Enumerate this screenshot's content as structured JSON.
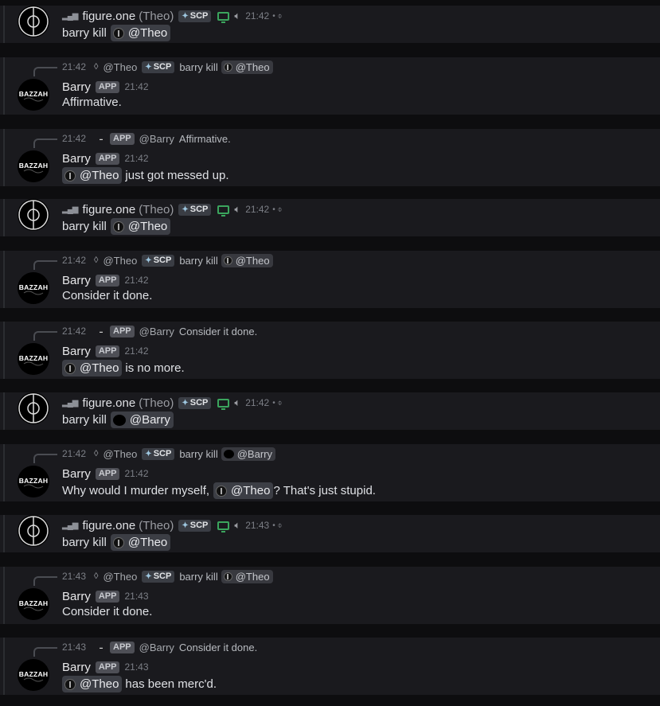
{
  "colors": {
    "background": "#0d0d0f",
    "message_bg": "#1a1a1e",
    "mention_bg": "#3c3e45",
    "app_tag": "#4e4f56",
    "screen_share": "#3ba55d"
  },
  "icons": {
    "figure_avatar": "crosshair-circle",
    "bazzah_avatar": "bazzah-logo",
    "signal": "signal-bars-icon",
    "screen": "screen-share-icon",
    "speaker": "speaker-icon"
  },
  "messages": [
    {
      "kind": "figure",
      "name": "figure.one",
      "alias": "(Theo)",
      "tag": "SCP",
      "time": "21:42",
      "suffix": "• ⌽",
      "text": "barry kill",
      "mention": "@Theo",
      "mention_type": "theo"
    },
    {
      "kind": "barry",
      "reply": {
        "time": "21:42",
        "name": "@Theo",
        "tag": "SCP",
        "text": "barry kill",
        "mention": "@Theo",
        "mention_type": "theo"
      },
      "name": "Barry",
      "tag": "APP",
      "time": "21:42",
      "pre": "",
      "mention": "",
      "post": "Affirmative."
    },
    {
      "kind": "barry",
      "reply": {
        "time": "21:42",
        "name": "@Barry",
        "tag": "APP",
        "text": "Affirmative.",
        "mention": "",
        "mention_type": ""
      },
      "name": "Barry",
      "tag": "APP",
      "time": "21:42",
      "pre": "",
      "mention": "@Theo",
      "post": "just got messed up."
    },
    {
      "kind": "figure",
      "name": "figure.one",
      "alias": "(Theo)",
      "tag": "SCP",
      "time": "21:42",
      "suffix": "• ⌽",
      "text": "barry kill",
      "mention": "@Theo",
      "mention_type": "theo"
    },
    {
      "kind": "barry",
      "reply": {
        "time": "21:42",
        "name": "@Theo",
        "tag": "SCP",
        "text": "barry kill",
        "mention": "@Theo",
        "mention_type": "theo"
      },
      "name": "Barry",
      "tag": "APP",
      "time": "21:42",
      "pre": "",
      "mention": "",
      "post": "Consider it done."
    },
    {
      "kind": "barry",
      "reply": {
        "time": "21:42",
        "name": "@Barry",
        "tag": "APP",
        "text": "Consider it done.",
        "mention": "",
        "mention_type": ""
      },
      "name": "Barry",
      "tag": "APP",
      "time": "21:42",
      "pre": "",
      "mention": "@Theo",
      "post": "is no more."
    },
    {
      "kind": "figure",
      "name": "figure.one",
      "alias": "(Theo)",
      "tag": "SCP",
      "time": "21:42",
      "suffix": "• ⌽",
      "text": "barry kill",
      "mention": "@Barry",
      "mention_type": "barry"
    },
    {
      "kind": "barry",
      "reply": {
        "time": "21:42",
        "name": "@Theo",
        "tag": "SCP",
        "text": "barry kill",
        "mention": "@Barry",
        "mention_type": "barry"
      },
      "name": "Barry",
      "tag": "APP",
      "time": "21:42",
      "pre": "Why would I murder myself,",
      "mention": "@Theo",
      "post": "? That's just stupid."
    },
    {
      "kind": "figure",
      "name": "figure.one",
      "alias": "(Theo)",
      "tag": "SCP",
      "time": "21:43",
      "suffix": "• ⌽",
      "text": "barry kill",
      "mention": "@Theo",
      "mention_type": "theo"
    },
    {
      "kind": "barry",
      "reply": {
        "time": "21:43",
        "name": "@Theo",
        "tag": "SCP",
        "text": "barry kill",
        "mention": "@Theo",
        "mention_type": "theo"
      },
      "name": "Barry",
      "tag": "APP",
      "time": "21:43",
      "pre": "",
      "mention": "",
      "post": "Consider it done."
    },
    {
      "kind": "barry",
      "reply": {
        "time": "21:43",
        "name": "@Barry",
        "tag": "APP",
        "text": "Consider it done.",
        "mention": "",
        "mention_type": ""
      },
      "name": "Barry",
      "tag": "APP",
      "time": "21:43",
      "pre": "",
      "mention": "@Theo",
      "post": "has been merc'd."
    }
  ],
  "avatar_text": "BAZZAH"
}
